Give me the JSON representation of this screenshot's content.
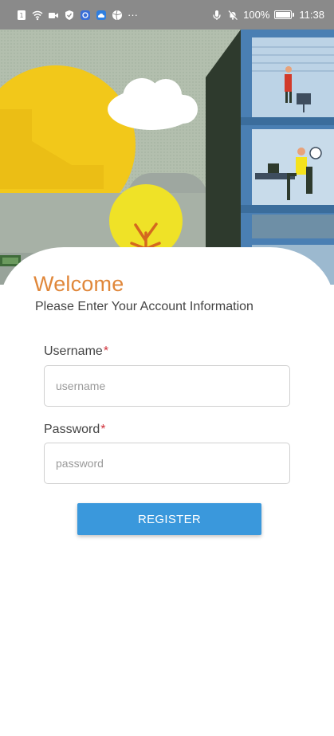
{
  "status_bar": {
    "battery_percent": "100%",
    "time": "11:38",
    "more_indicator": "···",
    "left_icons": [
      "sim-icon",
      "wifi-icon",
      "video-icon",
      "shield-icon",
      "app-icon",
      "cloud-icon",
      "ball-icon"
    ],
    "right_icons": [
      "mic-icon",
      "mute-bell-icon",
      "battery-icon"
    ]
  },
  "hero": {
    "description_icons": [
      "sun-icon",
      "cloud-icon",
      "tree-icon",
      "building-icon",
      "office-worker-icon"
    ]
  },
  "form": {
    "title": "Welcome",
    "subtitle": "Please Enter Your Account Information",
    "username": {
      "label": "Username",
      "required_mark": "*",
      "placeholder": "username",
      "value": ""
    },
    "password": {
      "label": "Password",
      "required_mark": "*",
      "placeholder": "password",
      "value": ""
    },
    "submit_label": "REGISTER"
  },
  "colors": {
    "accent_title": "#e0873a",
    "button": "#3a98dc",
    "required": "#d0313b",
    "status_bar": "#8a8a8a"
  }
}
